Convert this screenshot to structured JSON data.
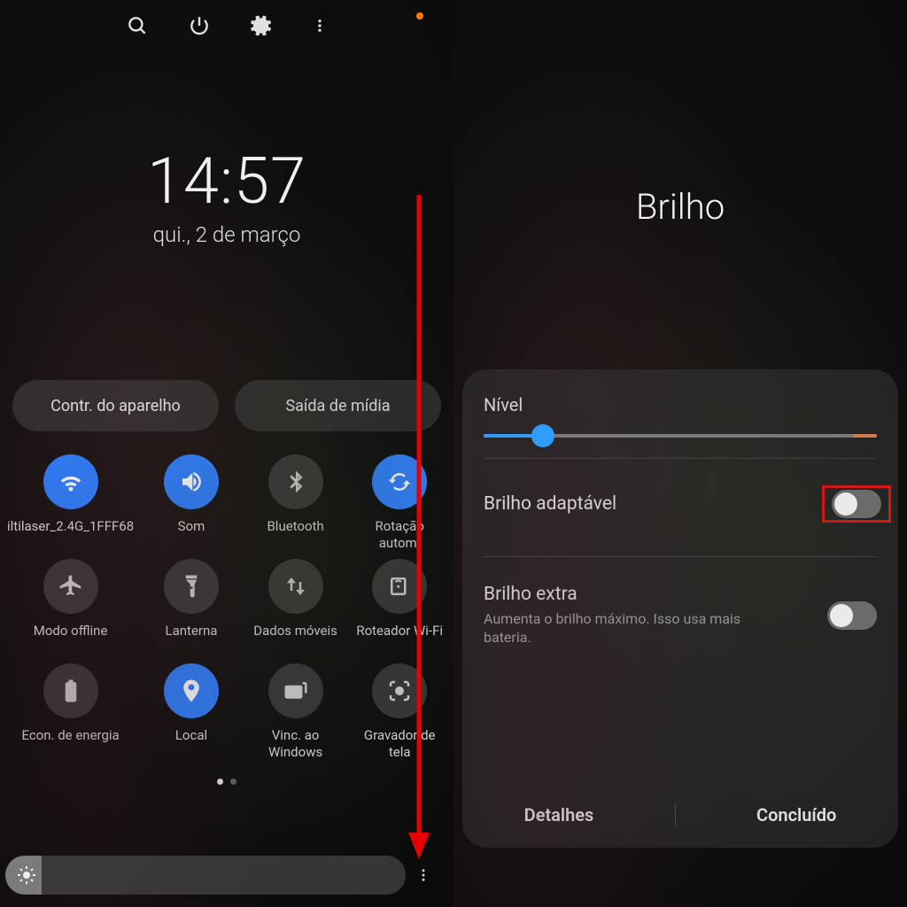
{
  "left": {
    "clock": {
      "time": "14:57",
      "date": "qui., 2 de março"
    },
    "pills": {
      "device_controls": "Contr. do aparelho",
      "media_output": "Saída de mídia"
    },
    "tiles": [
      {
        "key": "wifi",
        "label": "iltilaser_2.4G_1FFF68",
        "on": true,
        "icon": "wifi"
      },
      {
        "key": "sound",
        "label": "Som",
        "on": true,
        "icon": "volume"
      },
      {
        "key": "bluetooth",
        "label": "Bluetooth",
        "on": false,
        "icon": "bluetooth"
      },
      {
        "key": "rotation",
        "label": "Rotação autom.",
        "on": true,
        "icon": "rotate"
      },
      {
        "key": "airplane",
        "label": "Modo offline",
        "on": false,
        "icon": "airplane"
      },
      {
        "key": "flashlight",
        "label": "Lanterna",
        "on": false,
        "icon": "flashlight"
      },
      {
        "key": "data",
        "label": "Dados móveis",
        "on": false,
        "icon": "data"
      },
      {
        "key": "hotspot",
        "label": "Roteador Wi-Fi",
        "on": false,
        "icon": "hotspot"
      },
      {
        "key": "battery",
        "label": "Econ. de energia",
        "on": false,
        "icon": "battery"
      },
      {
        "key": "location",
        "label": "Local",
        "on": true,
        "icon": "location"
      },
      {
        "key": "windows",
        "label": "Vinc. ao Windows",
        "on": false,
        "icon": "windows"
      },
      {
        "key": "recorder",
        "label": "Gravador de tela",
        "on": false,
        "icon": "record"
      }
    ],
    "brightness_percent": 9
  },
  "right": {
    "title": "Brilho",
    "level_label": "Nível",
    "level_percent": 15,
    "adaptive": {
      "label": "Brilho adaptável",
      "on": false,
      "highlighted": true
    },
    "extra": {
      "label": "Brilho extra",
      "sub": "Aumenta o brilho máximo. Isso usa mais bateria.",
      "on": false
    },
    "footer": {
      "details": "Detalhes",
      "done": "Concluído"
    }
  },
  "colors": {
    "accent": "#2f80ff",
    "highlight": "#e11"
  }
}
